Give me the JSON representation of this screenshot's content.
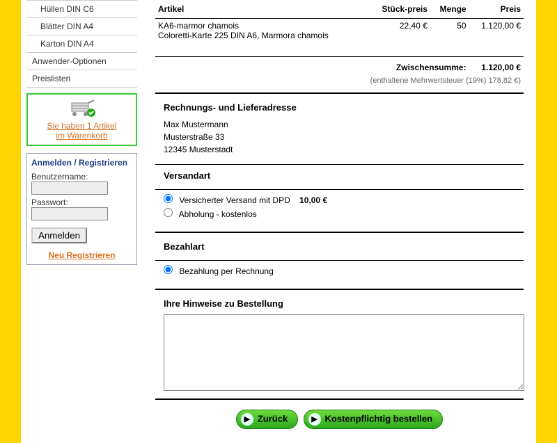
{
  "sidebar": {
    "items": [
      {
        "label": "Hüllen DIN C6"
      },
      {
        "label": "Blätter DIN A4"
      },
      {
        "label": "Karton DIN A4"
      }
    ],
    "options": "Anwender-Optionen",
    "pricelists": "Preislisten"
  },
  "cart": {
    "line1": "Sie haben 1 Artikel",
    "line2": "im Warenkorb"
  },
  "login": {
    "title": "Anmelden / Registrieren",
    "user_label": "Benutzername:",
    "pass_label": "Passwort:",
    "submit": "Anmelden",
    "register": "Neu Registrieren"
  },
  "order": {
    "headers": {
      "article": "Artikel",
      "unit": "Stück-preis",
      "qty": "Menge",
      "price": "Preis"
    },
    "item": {
      "sku": "KA6-marmor chamois",
      "desc": "Coloretti-Karte 225 DIN A6, Marmora chamois",
      "unit": "22,40 €",
      "qty": "50",
      "price": "1.120,00 €"
    },
    "subtotal_label": "Zwischensumme:",
    "subtotal": "1.120,00 €",
    "tax_note": "(enthaltene Mehrwertsteuer (19%) 178,82 €)"
  },
  "address": {
    "heading": "Rechnungs- und Lieferadresse",
    "name": "Max Mustermann",
    "street": "Musterstraße 33",
    "city": "12345 Musterstadt"
  },
  "shipping": {
    "heading": "Versandart",
    "opt1": "Versicherter Versand mit DPD",
    "opt1_price": "10,00 €",
    "opt2": "Abholung - kostenlos"
  },
  "payment": {
    "heading": "Bezahlart",
    "opt1": "Bezahlung per Rechnung"
  },
  "notes": {
    "heading": "Ihre Hinweise zu Bestellung"
  },
  "buttons": {
    "back": "Zurück",
    "order": "Kostenpflichtig bestellen"
  }
}
